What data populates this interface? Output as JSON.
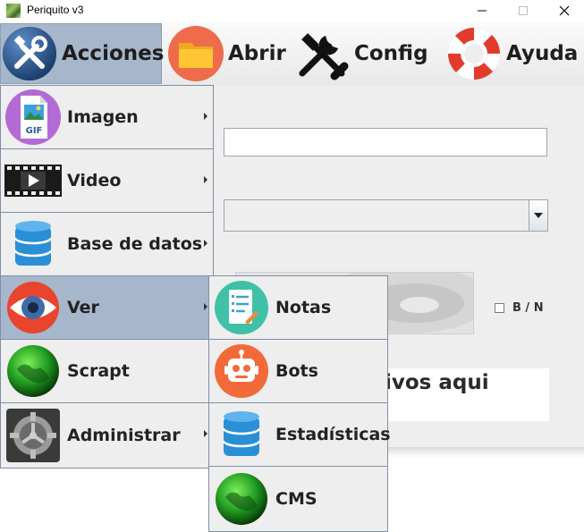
{
  "window": {
    "title": "Periquito v3"
  },
  "menubar": {
    "items": [
      {
        "label": "Acciones",
        "icon": "tools-icon",
        "selected": true
      },
      {
        "label": "Abrir",
        "icon": "folder-icon"
      },
      {
        "label": "Config",
        "icon": "wrench-screwdriver-icon"
      },
      {
        "label": "Ayuda",
        "icon": "lifebuoy-icon"
      }
    ]
  },
  "acciones_menu": {
    "items": [
      {
        "label": "Imagen",
        "icon": "gif-image-icon"
      },
      {
        "label": "Video",
        "icon": "film-play-icon"
      },
      {
        "label": "Base de datos",
        "icon": "database-icon"
      },
      {
        "label": "Ver",
        "icon": "eye-icon",
        "active": true
      },
      {
        "label": "Scrapt",
        "icon": "green-globe-icon"
      },
      {
        "label": "Administrar",
        "icon": "gear-icon"
      }
    ]
  },
  "ver_submenu": {
    "items": [
      {
        "label": "Notas",
        "icon": "notes-icon"
      },
      {
        "label": "Bots",
        "icon": "robot-icon"
      },
      {
        "label": "Estadísticas",
        "icon": "database-icon"
      },
      {
        "label": "CMS",
        "icon": "green-globe-icon"
      }
    ]
  },
  "form": {
    "text_value": "",
    "combo_value": "",
    "bn_label": "B / N",
    "bn_checked": false,
    "drop_text": "chivos aqui"
  },
  "colors": {
    "menu_selected": "#a6b7cb",
    "menu_border": "#7e8fa8",
    "panel_bg": "#eeeeee"
  }
}
